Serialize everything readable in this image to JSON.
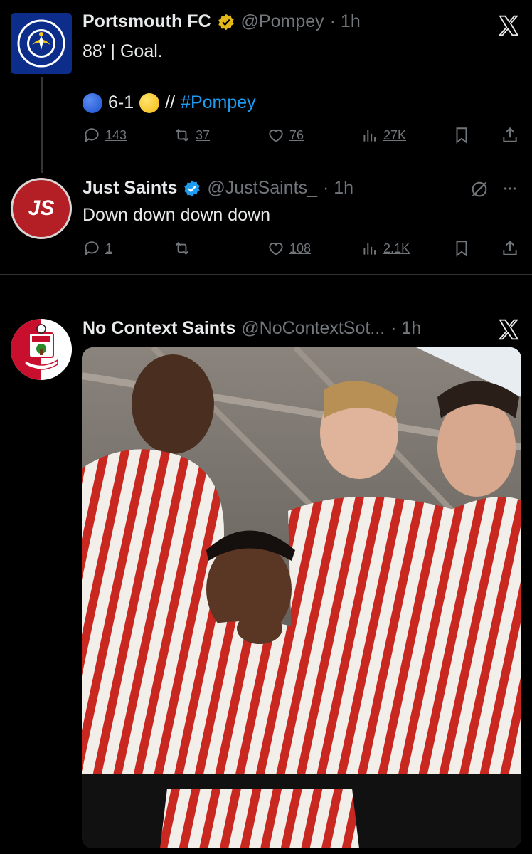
{
  "tweets": [
    {
      "name": "Portsmouth FC",
      "handle": "@Pompey",
      "time": "· 1h",
      "line1": "88' | Goal.",
      "score": "6-1",
      "rest": "//",
      "hashtag": "#Pompey",
      "replies": "143",
      "retweets": "37",
      "likes": "76",
      "views": "27K",
      "avatar_text": "PORTSMOUTH FOOTBALL CLUB"
    },
    {
      "name": "Just Saints",
      "handle": "@JustSaints_",
      "time": "· 1h",
      "text": "Down down down down",
      "replies": "1",
      "retweets": "",
      "likes": "108",
      "views": "2.1K",
      "avatar_text": "JS"
    },
    {
      "name": "No Context Saints",
      "handle": "@NoContextSot...",
      "time": "· 1h"
    }
  ],
  "colors": {
    "verified_gold": "#e2b719",
    "verified_blue": "#1d9bf0",
    "pompey_blue": "#0c2e8a",
    "saints_red": "#b41f25"
  },
  "icons": [
    "x-logo-icon",
    "reply-icon",
    "retweet-icon",
    "like-icon",
    "views-icon",
    "bookmark-icon",
    "share-icon",
    "grok-icon",
    "more-icon"
  ]
}
